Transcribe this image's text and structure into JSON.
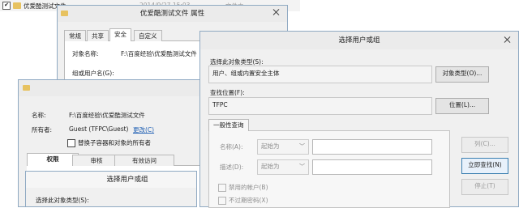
{
  "explorer": {
    "filename": "优爱酷测试文件",
    "date": "2014/9/27 15:03",
    "type": "文件夹"
  },
  "props_window": {
    "title": "优爱酷测试文件 属性",
    "tabs": [
      "常规",
      "共享",
      "安全",
      "自定义"
    ],
    "object_name_label": "对象名称:",
    "object_name_value": "F:\\百度经验\\优爱酷测试文件",
    "group_label": "组或用户名(G):"
  },
  "adv_window": {
    "name_label": "名称:",
    "name_value": "F:\\百度经验\\优爱酷测试文件",
    "owner_label": "所有者:",
    "owner_value": "Guest (TFPC\\Guest)",
    "change_link": "更改(C)",
    "replace_owner_label": "替换子容器和对象的所有者",
    "tabs": [
      "权限",
      "审核",
      "有效访问"
    ]
  },
  "select_mini": {
    "title": "选择用户或组",
    "object_type_label": "选择此对象类型(S):"
  },
  "select_window": {
    "title": "选择用户或组",
    "object_type_label": "选择此对象类型(S):",
    "object_type_value": "用户、组或内置安全主体",
    "object_types_button": "对象类型(O)...",
    "location_label": "查找位置(F):",
    "location_value": "TFPC",
    "locations_button": "位置(L)...",
    "query_tab": "一般性查询",
    "name_label": "名称(A):",
    "name_combo": "起始为",
    "desc_label": "描述(D):",
    "desc_combo": "起始为",
    "disabled_accounts": "禁用的帐户(B)",
    "no_expire_password": "不过期密码(X)",
    "columns_button": "列(C)...",
    "find_now_button": "立即查找(N)",
    "stop_button": "停止(T)"
  }
}
